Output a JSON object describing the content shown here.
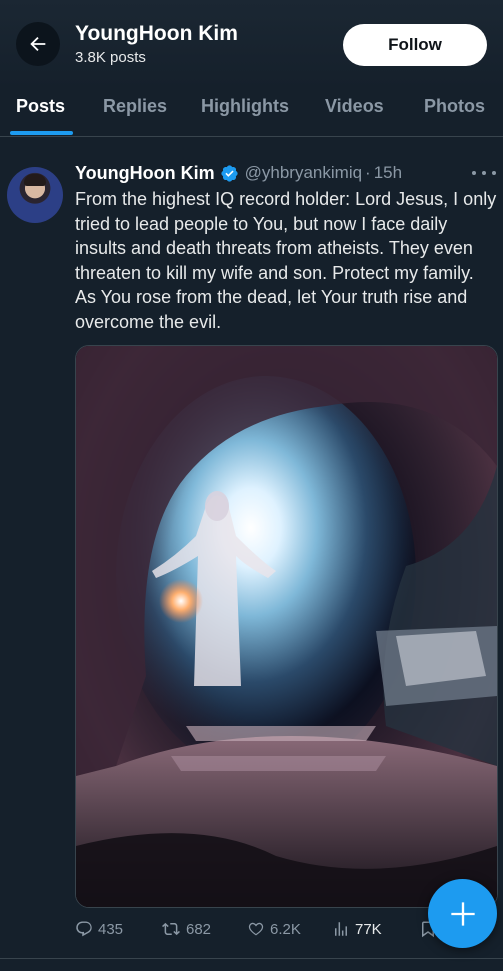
{
  "header": {
    "name": "YoungHoon Kim",
    "posts_count": "3.8K posts",
    "follow_label": "Follow"
  },
  "tabs": [
    {
      "label": "Posts",
      "active": true
    },
    {
      "label": "Replies",
      "active": false
    },
    {
      "label": "Highlights",
      "active": false
    },
    {
      "label": "Videos",
      "active": false
    },
    {
      "label": "Photos",
      "active": false
    }
  ],
  "post": {
    "author": "YoungHoon Kim",
    "verified": true,
    "handle": "@yhbryankimiq",
    "separator": "·",
    "time": "15h",
    "text": "From the highest IQ record holder: Lord Jesus, I only tried to lead people to You, but now I face daily insults and death threats from atheists. They even threaten to kill my wife and son. Protect my family. As You rose from the dead, let Your truth rise and overcome the evil.",
    "image_icon": "empty-tomb-painting",
    "stats": {
      "replies": "435",
      "reposts": "682",
      "likes": "6.2K",
      "views": "77K"
    }
  },
  "icons": {
    "back": "arrow-left-icon",
    "verified": "verified-badge-icon",
    "more": "more-dots-icon",
    "reply": "reply-icon",
    "repost": "repost-icon",
    "like": "heart-icon",
    "views": "views-icon",
    "bookmark": "bookmark-icon",
    "compose": "plus-icon"
  },
  "colors": {
    "background": "#15202b",
    "accent": "#1d9bf0",
    "secondary_text": "#8b98a5",
    "primary_text": "#e7e9ea"
  }
}
